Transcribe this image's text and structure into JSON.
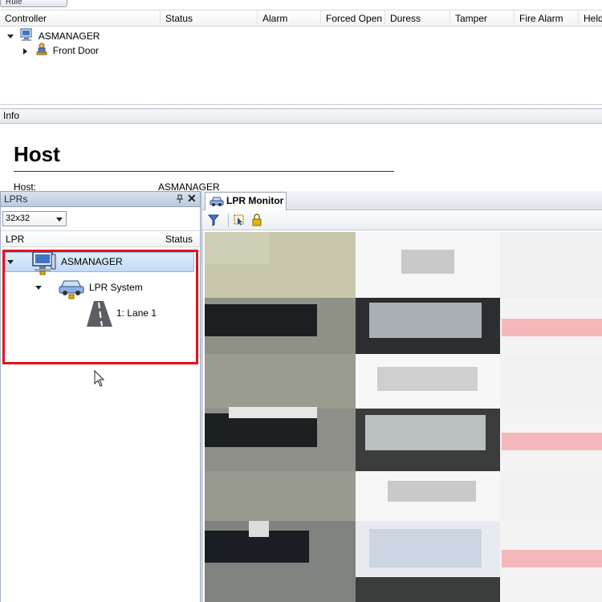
{
  "top_tab": {
    "label": "Rule"
  },
  "controller_grid": {
    "columns": [
      "Controller",
      "Status",
      "Alarm",
      "Forced Open",
      "Duress",
      "Tamper",
      "Fire Alarm",
      "Held"
    ],
    "rows": [
      {
        "label": "ASMANAGER",
        "icon": "server-icon",
        "expanded": true
      },
      {
        "label": "Front Door",
        "icon": "door-user-icon",
        "expanded": false
      }
    ]
  },
  "info": {
    "bar_label": "Info",
    "title": "Host",
    "host_label": "Host:",
    "host_value": "ASMANAGER"
  },
  "lprs_panel": {
    "title": "LPRs",
    "size_select": {
      "value": "32x32"
    },
    "columns": [
      "LPR",
      "Status"
    ],
    "tree": [
      {
        "label": "ASMANAGER",
        "icon": "server-icon",
        "selected": true
      },
      {
        "label": "LPR System",
        "icon": "car-system-icon"
      },
      {
        "label": "1: Lane 1",
        "icon": "road-lane-icon"
      }
    ]
  },
  "monitor": {
    "tab_label": "LPR Monitor",
    "toolbar": [
      "filter-icon",
      "select-icon",
      "lock-icon"
    ]
  },
  "colors": {
    "highlight": "#e8101a",
    "selection": "#bfdcf6",
    "panel_header": "#bccbdd"
  }
}
